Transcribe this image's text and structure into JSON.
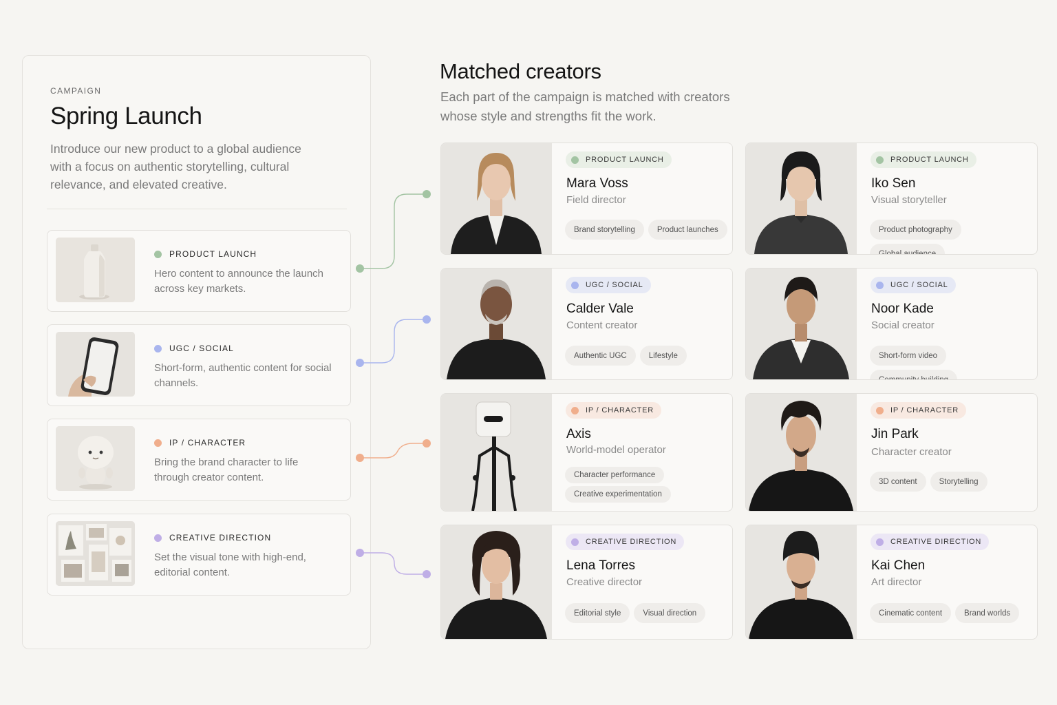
{
  "campaign": {
    "eyebrow": "CAMPAIGN",
    "title": "Spring Launch",
    "description": "Introduce our new product to a global audience with a focus on authentic storytelling, cultural relevance, and elevated creative.",
    "work_items": [
      {
        "tag": "PRODUCT LAUNCH",
        "description": "Hero content to announce the launch across key markets.",
        "color": "#a3c4a3",
        "thumb": "bottle"
      },
      {
        "tag": "UGC / SOCIAL",
        "description": "Short-form, authentic content for social channels.",
        "color": "#a9b5ee",
        "thumb": "phone-in-hand"
      },
      {
        "tag": "IP / CHARACTER",
        "description": "Bring the brand character to life through creator content.",
        "color": "#f0ae8c",
        "thumb": "mascot-figure"
      },
      {
        "tag": "CREATIVE DIRECTION",
        "description": "Set the visual tone with high-end, editorial content.",
        "color": "#bfaee6",
        "thumb": "moodboard"
      }
    ]
  },
  "matched": {
    "title": "Matched creators",
    "subtitle": "Each part of the campaign is matched with creators whose style and strengths fit the work."
  },
  "creators": [
    {
      "tag": "PRODUCT LAUNCH",
      "name": "Mara Voss",
      "role": "Field director",
      "skills": [
        "Brand storytelling",
        "Product launches"
      ]
    },
    {
      "tag": "PRODUCT LAUNCH",
      "name": "Iko Sen",
      "role": "Visual storyteller",
      "skills": [
        "Product photography",
        "Global audience"
      ]
    },
    {
      "tag": "UGC / SOCIAL",
      "name": "Calder Vale",
      "role": "Content creator",
      "skills": [
        "Authentic UGC",
        "Lifestyle"
      ]
    },
    {
      "tag": "UGC / SOCIAL",
      "name": "Noor Kade",
      "role": "Social creator",
      "skills": [
        "Short-form video",
        "Community building"
      ]
    },
    {
      "tag": "IP / CHARACTER",
      "name": "Axis",
      "role": "World-model operator",
      "skills": [
        "Character performance",
        "Creative experimentation"
      ]
    },
    {
      "tag": "IP / CHARACTER",
      "name": "Jin Park",
      "role": "Character creator",
      "skills": [
        "3D content",
        "Storytelling"
      ]
    },
    {
      "tag": "CREATIVE DIRECTION",
      "name": "Lena Torres",
      "role": "Creative director",
      "skills": [
        "Editorial style",
        "Visual direction"
      ]
    },
    {
      "tag": "CREATIVE DIRECTION",
      "name": "Kai Chen",
      "role": "Art director",
      "skills": [
        "Cinematic content",
        "Brand worlds"
      ]
    }
  ],
  "tag_styles": {
    "PRODUCT LAUNCH": {
      "dot": "#a3c4a3",
      "bg": "#e9efe6"
    },
    "UGC / SOCIAL": {
      "dot": "#a9b5ee",
      "bg": "#e6e9f5"
    },
    "IP / CHARACTER": {
      "dot": "#f0ae8c",
      "bg": "#f8e9e1"
    },
    "CREATIVE DIRECTION": {
      "dot": "#bfaee6",
      "bg": "#ece7f5"
    }
  }
}
